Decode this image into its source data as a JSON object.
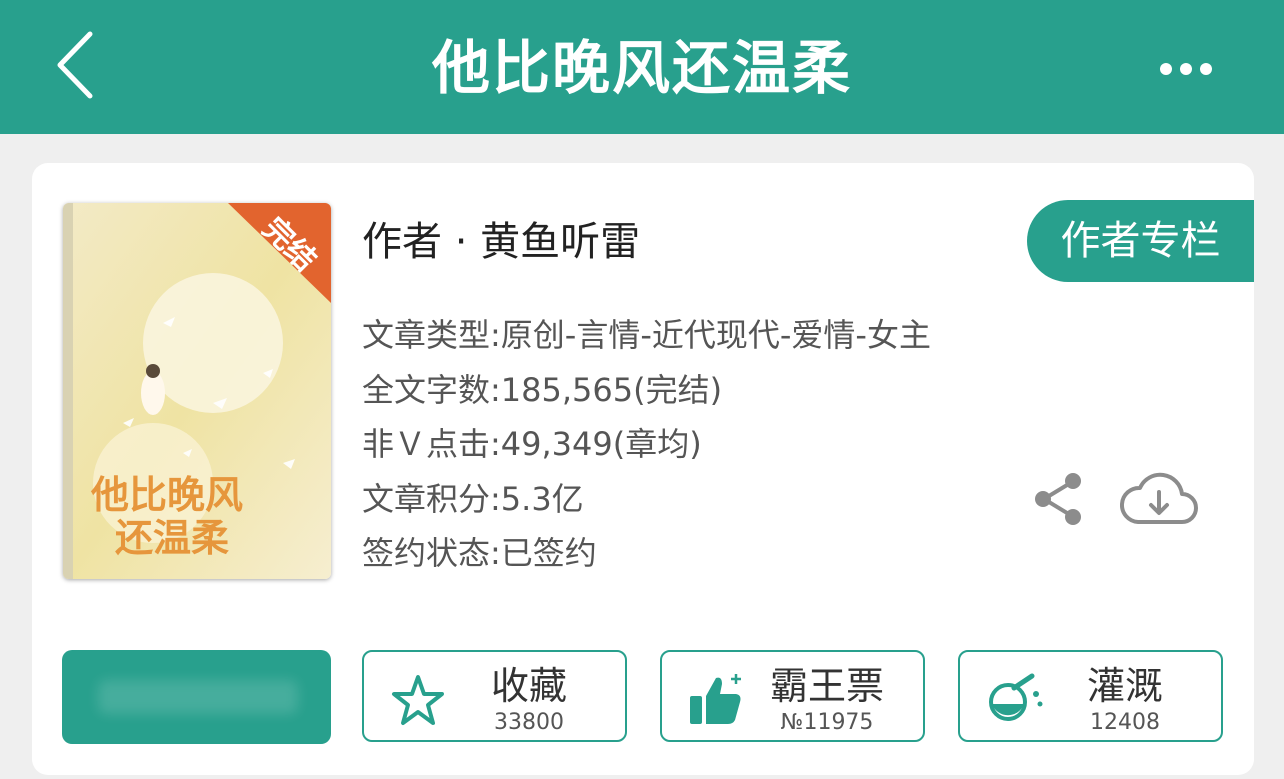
{
  "header": {
    "title": "他比晚风还温柔"
  },
  "book": {
    "cover_badge": "完结",
    "cover_title_line1": "他比晚风",
    "cover_title_line2": "还温柔",
    "author": "作者 · 黄鱼听雷",
    "author_column_label": "作者专栏",
    "info": [
      "文章类型:原创-言情-近代现代-爱情-女主",
      "全文字数:185,565(完结)",
      "非Ｖ点击:49,349(章均)",
      "文章积分:5.3亿",
      "签约状态:已签约"
    ]
  },
  "actions": {
    "favorite": {
      "label": "收藏",
      "count": "33800"
    },
    "ticket": {
      "label": "霸王票",
      "count": "№11975"
    },
    "nutrient": {
      "label": "灌溉",
      "count": "12408"
    }
  },
  "colors": {
    "accent": "#28a08d",
    "header_text": "#ffffff"
  },
  "icons": [
    "back-icon",
    "more-icon",
    "share-icon",
    "download-cloud-icon",
    "star-icon",
    "thumbs-up-icon",
    "flask-icon"
  ]
}
